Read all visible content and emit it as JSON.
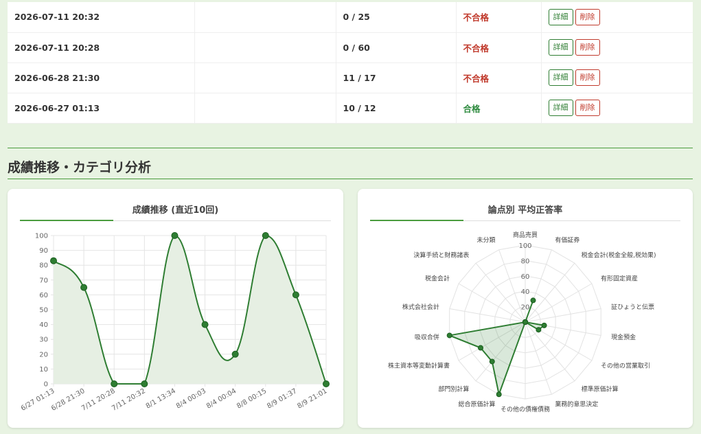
{
  "history": {
    "rows": [
      {
        "date": "2026-07-11 20:32",
        "score": "0 / 25",
        "result": "不合格",
        "status": "fail"
      },
      {
        "date": "2026-07-11 20:28",
        "score": "0 / 60",
        "result": "不合格",
        "status": "fail"
      },
      {
        "date": "2026-06-28 21:30",
        "score": "11 / 17",
        "result": "不合格",
        "status": "fail"
      },
      {
        "date": "2026-06-27 01:13",
        "score": "10 / 12",
        "result": "合格",
        "status": "pass"
      }
    ],
    "detail_label": "詳細",
    "delete_label": "削除"
  },
  "section": {
    "title": "成績推移・カテゴリ分析"
  },
  "colors": {
    "accent": "#2e7d32",
    "fill": "#e6efe3",
    "fail": "#c0392b",
    "pass": "#2e8b3f"
  },
  "chart_data": [
    {
      "type": "line",
      "title": "成績推移 (直近10回)",
      "categories": [
        "6/27 01:13",
        "6/28 21:30",
        "7/11 20:28",
        "7/11 20:32",
        "8/1 13:34",
        "8/4 00:03",
        "8/4 00:04",
        "8/8 00:15",
        "8/9 01:37",
        "8/9 21:01"
      ],
      "values": [
        83,
        65,
        0,
        0,
        100,
        40,
        20,
        100,
        60,
        0
      ],
      "ylim": [
        0,
        100
      ],
      "yticks": [
        0,
        10,
        20,
        30,
        40,
        50,
        60,
        70,
        80,
        90,
        100
      ],
      "grid": true,
      "filled": true
    },
    {
      "type": "radar",
      "title": "論点別 平均正答率",
      "categories": [
        "商品売買",
        "有価証券",
        "税金会計(税金全般,税効果)",
        "有形固定資産",
        "証ひょうと伝票",
        "現金預金",
        "その他の営業取引",
        "標準原価計算",
        "業務的意思決定",
        "その他の債権債務",
        "総合原価計算",
        "部門別計算",
        "株主資本等変動計算書",
        "吸収合併",
        "株式会社会計",
        "税金会計",
        "決算手続と財務諸表",
        "未分類"
      ],
      "values": [
        0,
        30,
        0,
        0,
        0,
        25,
        20,
        0,
        0,
        0,
        100,
        67,
        67,
        100,
        0,
        0,
        0,
        0
      ],
      "rlim": [
        0,
        100
      ],
      "rticks": [
        20,
        40,
        60,
        80,
        100
      ]
    }
  ]
}
